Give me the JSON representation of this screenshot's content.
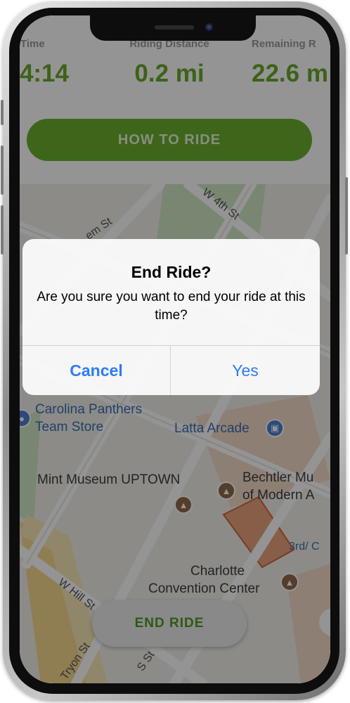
{
  "stats": [
    {
      "label": "ing Time",
      "value": "4:14"
    },
    {
      "label": "Riding Distance",
      "value": "0.2 mi"
    },
    {
      "label": "Remaining R",
      "value": "22.6 m"
    }
  ],
  "how_to_ride_label": "HOW TO RIDE",
  "end_ride_label": "END RIDE",
  "map": {
    "streets": [
      "W 4th St",
      "em St",
      "W Hill St",
      "Tryon St",
      "S St"
    ],
    "pois": {
      "panthers_line1": "Carolina Panthers",
      "panthers_line2": "Team Store",
      "latta": "Latta Arcade",
      "mint": "Mint Museum UPTOWN",
      "bechtler_line1": "Bechtler Mu",
      "bechtler_line2": "of Modern A",
      "third": "3rd/ C",
      "charlotte_line1": "Charlotte",
      "charlotte_line2": "Convention Center"
    }
  },
  "alert": {
    "title": "End Ride?",
    "message": "Are you sure you want to end your ride at this time?",
    "cancel_label": "Cancel",
    "confirm_label": "Yes"
  },
  "colors": {
    "accent_green": "#6ab02e",
    "ios_blue": "#2f7cf6"
  }
}
